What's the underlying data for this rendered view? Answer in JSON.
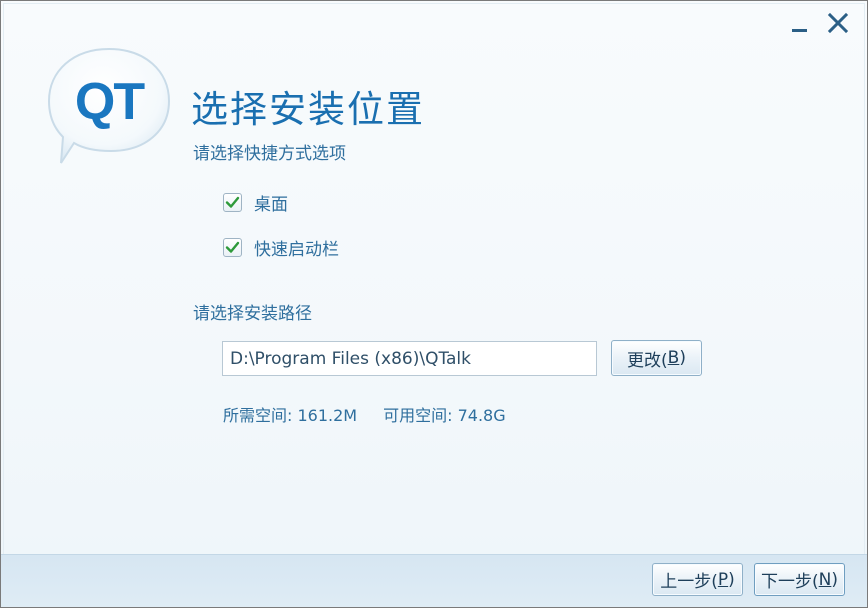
{
  "window": {
    "minimize_icon": "minimize-icon",
    "close_icon": "close-icon"
  },
  "logo": {
    "text": "QT",
    "icon": "qtalk-logo-icon"
  },
  "header": {
    "title": "选择安装位置",
    "subtitle": "请选择快捷方式选项"
  },
  "shortcuts": [
    {
      "label": "桌面",
      "checked": true
    },
    {
      "label": "快速启动栏",
      "checked": true
    }
  ],
  "install_path": {
    "label": "请选择安装路径",
    "value": "D:\\Program Files (x86)\\QTalk",
    "change_button": {
      "text": "更改(",
      "key": "B",
      "close": ")"
    }
  },
  "space": {
    "required_label": "所需空间: ",
    "required_value": "161.2M",
    "available_label": "可用空间: ",
    "available_value": "74.8G"
  },
  "footer": {
    "prev_button": {
      "text": "上一步(",
      "key": "P",
      "close": ")"
    },
    "next_button": {
      "text": "下一步(",
      "key": "N",
      "close": ")"
    }
  },
  "colors": {
    "accent": "#1a6fb0",
    "text": "#2f6f9e",
    "check": "#2e9a3a",
    "footer_bg": "#d6e6f2"
  }
}
